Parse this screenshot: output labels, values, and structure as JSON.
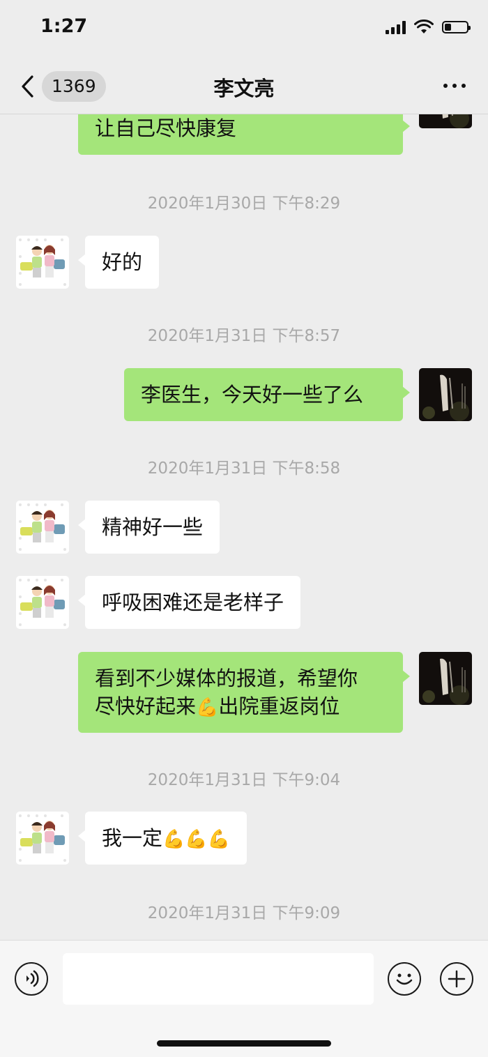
{
  "status_bar": {
    "time": "1:27",
    "battery_level": 0.3
  },
  "nav": {
    "unread_count": "1369",
    "title": "李文亮"
  },
  "messages": [
    {
      "kind": "text",
      "side": "out",
      "text": "让自己尽快康复"
    },
    {
      "kind": "timestamp",
      "text": "2020年1月30日 下午8:29"
    },
    {
      "kind": "text",
      "side": "in",
      "text": "好的"
    },
    {
      "kind": "timestamp",
      "text": "2020年1月31日 下午8:57"
    },
    {
      "kind": "text",
      "side": "out",
      "text": "李医生，今天好一些了么"
    },
    {
      "kind": "timestamp",
      "text": "2020年1月31日 下午8:58"
    },
    {
      "kind": "text",
      "side": "in",
      "text": "精神好一些"
    },
    {
      "kind": "text",
      "side": "in",
      "text": "呼吸困难还是老样子"
    },
    {
      "kind": "text",
      "side": "out",
      "line1": "看到不少媒体的报道，希望你",
      "line2_before": "尽快好起来",
      "line2_emoji": "💪",
      "line2_after": "出院重返岗位"
    },
    {
      "kind": "timestamp",
      "text": "2020年1月31日 下午9:04"
    },
    {
      "kind": "text",
      "side": "in",
      "text": "我一定",
      "emoji": "💪💪💪"
    },
    {
      "kind": "timestamp",
      "text": "2020年1月31日 下午9:09"
    }
  ],
  "input_bar": {
    "placeholder": ""
  },
  "icons": {
    "back": "chevron-left-icon",
    "more": "more-dots-icon",
    "voice": "voice-icon",
    "emoji": "emoji-smile-icon",
    "plus": "plus-icon"
  },
  "colors": {
    "background": "#ededed",
    "outgoing_bubble": "#a4e57a",
    "incoming_bubble": "#ffffff",
    "timestamp_text": "#a8a8a8"
  }
}
